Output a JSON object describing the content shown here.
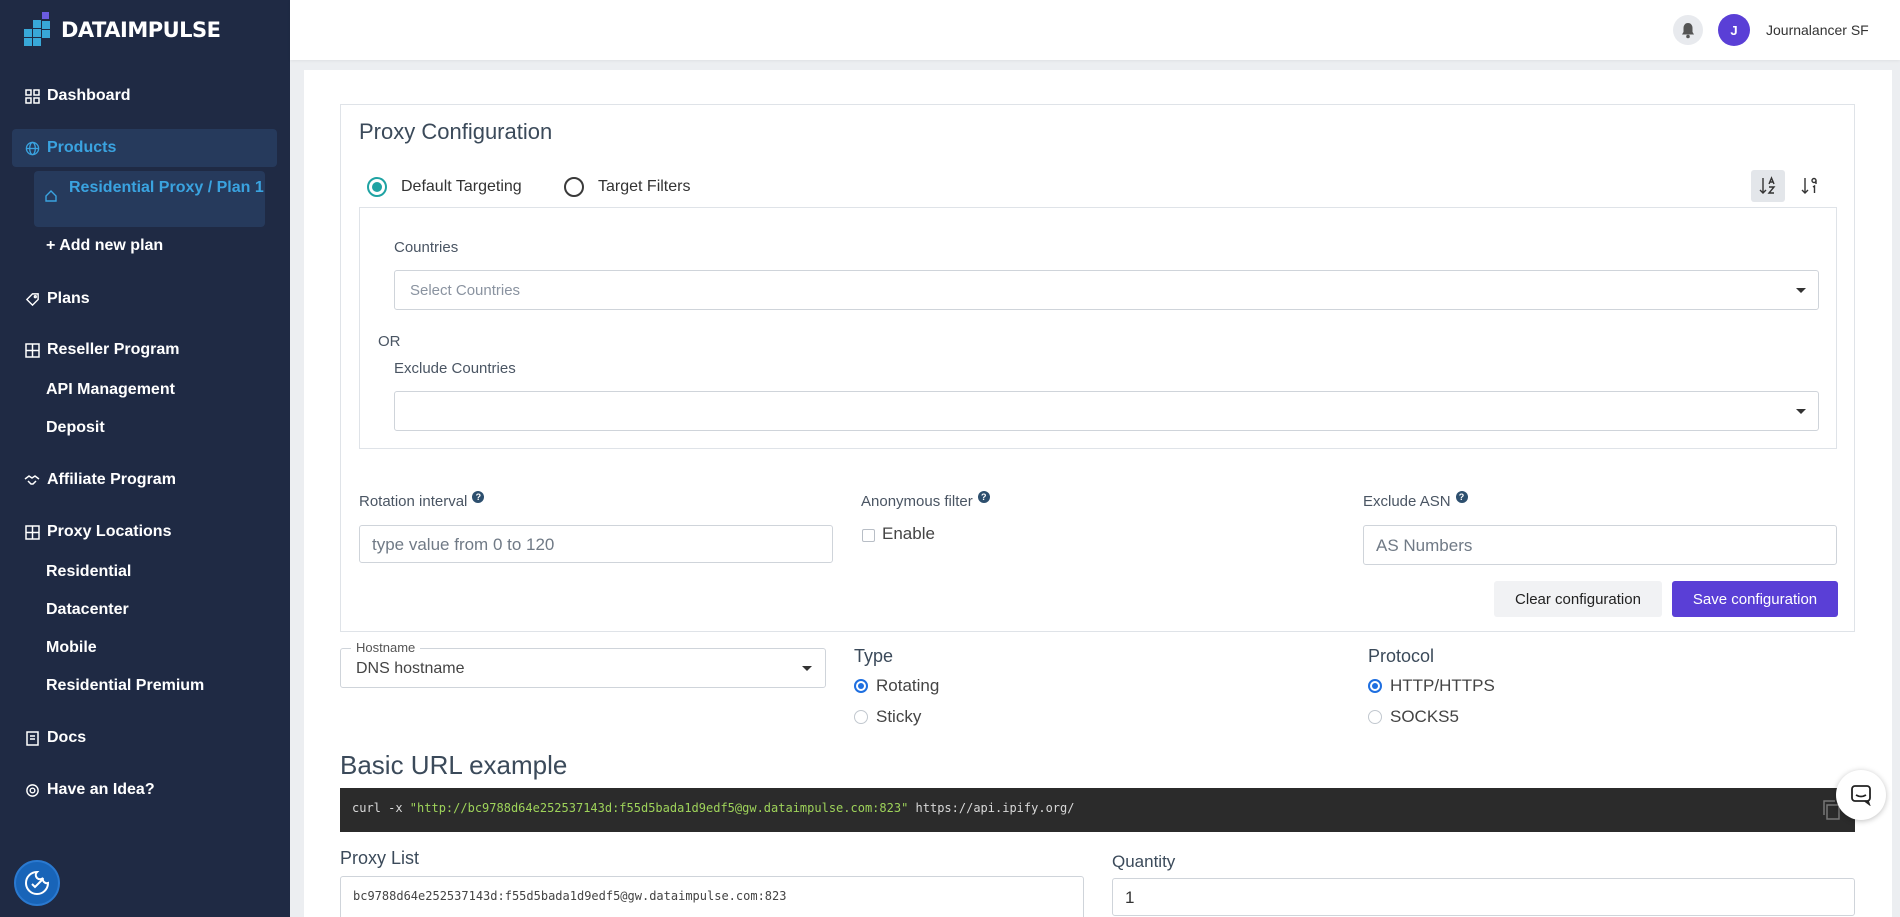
{
  "brand": {
    "name": "DATAIMPULSE",
    "accent": "#38a8d8",
    "primary": "#5a3fd6",
    "sidebar_bg": "#1f2a44"
  },
  "sidebar": {
    "dashboard": "Dashboard",
    "products": "Products",
    "product_sub": "Residential Proxy / Plan 1",
    "add_plan": "+ Add new plan",
    "plans": "Plans",
    "reseller": "Reseller Program",
    "api_management": "API Management",
    "deposit": "Deposit",
    "affiliate": "Affiliate Program",
    "proxy_locations": "Proxy Locations",
    "residential": "Residential",
    "datacenter": "Datacenter",
    "mobile": "Mobile",
    "residential_premium": "Residential Premium",
    "docs": "Docs",
    "idea": "Have an Idea?"
  },
  "topbar": {
    "avatar_initial": "J",
    "username": "Journalancer SF"
  },
  "config": {
    "title": "Proxy Configuration",
    "default_targeting": "Default Targeting",
    "target_filters": "Target Filters",
    "countries_label": "Countries",
    "countries_placeholder": "Select Countries",
    "or_label": "OR",
    "exclude_countries_label": "Exclude Countries",
    "rotation_label": "Rotation interval",
    "rotation_placeholder": "type value from 0 to 120",
    "anonymous_label": "Anonymous filter",
    "enable_label": "Enable",
    "exclude_asn_label": "Exclude ASN",
    "asn_placeholder": "AS Numbers",
    "help_glyph": "?",
    "clear_btn": "Clear configuration",
    "save_btn": "Save configuration"
  },
  "connection": {
    "hostname_legend": "Hostname",
    "hostname_value": "DNS hostname",
    "type_title": "Type",
    "type_options": [
      "Rotating",
      "Sticky"
    ],
    "protocol_title": "Protocol",
    "protocol_options": [
      "HTTP/HTTPS",
      "SOCKS5"
    ]
  },
  "example": {
    "title": "Basic URL example",
    "cmd": "curl -x ",
    "url": "\"http://bc9788d64e252537143d:f55d5bada1d9edf5@gw.dataimpulse.com:823\"",
    "target": " https://api.ipify.org/"
  },
  "proxy_list": {
    "label": "Proxy List",
    "value": "bc9788d64e252537143d:f55d5bada1d9edf5@gw.dataimpulse.com:823",
    "quantity_label": "Quantity",
    "quantity_value": "1"
  }
}
